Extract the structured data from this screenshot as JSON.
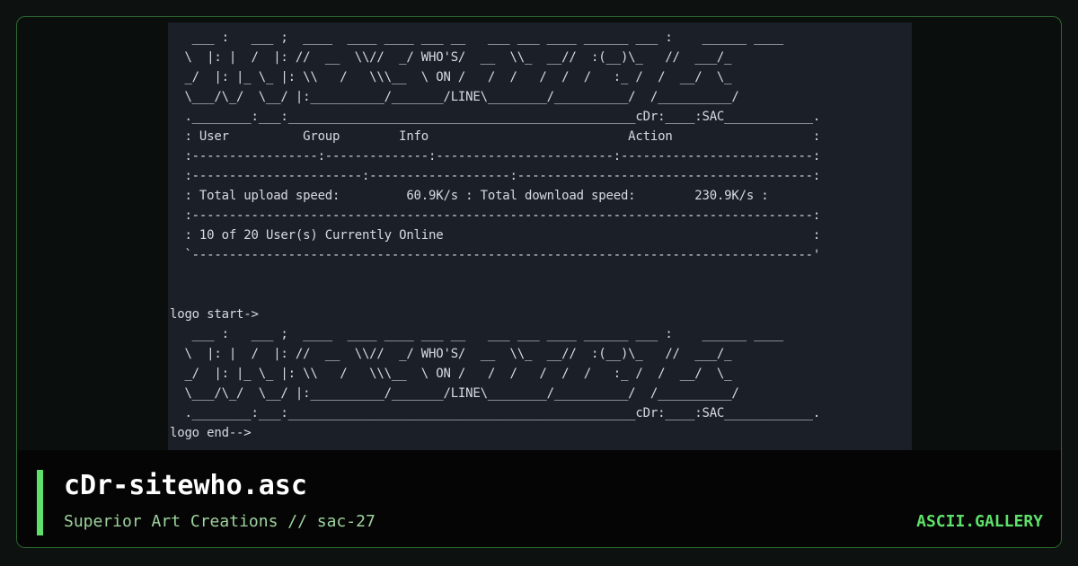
{
  "page": {
    "background": "#0d1210",
    "card_border": "#2a6b2f",
    "accent": "#5ee06a"
  },
  "preview": {
    "ascii_lines": [
      "   ___ :   ___ ;  ____  ____ ____ ___ __   ___ ___ ____ ______ ___ :    ______ ____",
      "  \\  |: |  /  |: //  __  \\\\//  _/ WHO'S/  __  \\\\_  __//  :(__)\\_   //  ___/_",
      "  _/  |: |_ \\_ |: \\\\   /   \\\\\\__  \\ ON /   /  /   /  /  /   :_ /  /  __/  \\_",
      "  \\___/\\_/  \\__/ |:__________/_______/LINE\\________/__________/  /__________/",
      "  .________:___:_______________________________________________cDr:____:SAC____________.",
      "  : User          Group        Info                           Action                   :",
      "  :-----------------:--------------:------------------------:--------------------------:",
      "  :-----------------------:-------------------:----------------------------------------:",
      "  : Total upload speed:         60.9K/s : Total download speed:        230.9K/s :",
      "  :------------------------------------------------------------------------------------:",
      "  : 10 of 20 User(s) Currently Online                                                  :",
      "  `------------------------------------------------------------------------------------'",
      "",
      "",
      "logo start->",
      "   ___ :   ___ ;  ____  ____ ____ ___ __   ___ ___ ____ ______ ___ :    ______ ____",
      "  \\  |: |  /  |: //  __  \\\\//  _/ WHO'S/  __  \\\\_  __//  :(__)\\_   //  ___/_",
      "  _/  |: |_ \\_ |: \\\\   /   \\\\\\__  \\ ON /   /  /   /  /  /   :_ /  /  __/  \\_",
      "  \\___/\\_/  \\__/ |:__________/_______/LINE\\________/__________/  /__________/",
      "  .________:___:_______________________________________________cDr:____:SAC____________.",
      "logo end-->"
    ]
  },
  "footer": {
    "title": "cDr-sitewho.asc",
    "subtitle": "Superior Art Creations // sac-27",
    "brand": "ASCII.GALLERY"
  }
}
